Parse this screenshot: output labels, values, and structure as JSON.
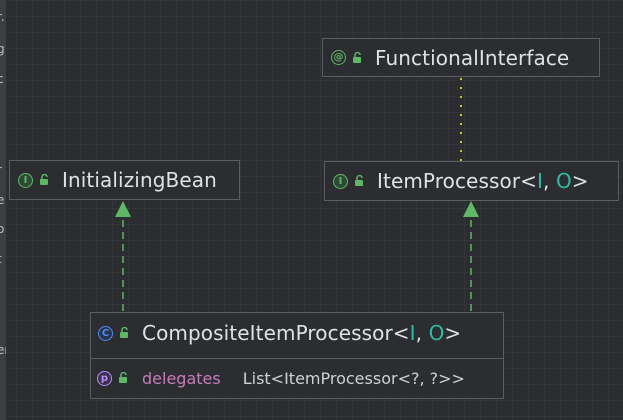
{
  "left_strip_fragments": [
    "r.",
    "g",
    "c",
    "r",
    "e",
    "o",
    "t",
    "er"
  ],
  "nodes": {
    "functional_interface": {
      "kind": "annotation",
      "badge": "@",
      "name": "FunctionalInterface"
    },
    "initializing_bean": {
      "kind": "interface",
      "badge": "I",
      "name": "InitializingBean"
    },
    "item_processor": {
      "kind": "interface",
      "badge": "I",
      "name": "ItemProcessor",
      "type_open": "<",
      "type_param_1": "I",
      "type_sep": ", ",
      "type_param_2": "O",
      "type_close": ">"
    },
    "composite_item_processor": {
      "kind": "class",
      "badge": "C",
      "name": "CompositeItemProcessor",
      "type_open": "<",
      "type_param_1": "I",
      "type_sep": ", ",
      "type_param_2": "O",
      "type_close": ">",
      "members": [
        {
          "badge": "p",
          "name": "delegates",
          "type": "List<ItemProcessor<?, ?>>"
        }
      ]
    }
  },
  "colors": {
    "background": "#2b2d30",
    "node_border": "#5a5d63",
    "implements_arrow": "#5fb865",
    "annotation_link": "#c4c433",
    "type_parameter": "#2fbaa3",
    "member_name": "#c77dbb"
  },
  "edges": [
    {
      "from": "composite_item_processor",
      "to": "initializing_bean",
      "style": "dashed-implements"
    },
    {
      "from": "composite_item_processor",
      "to": "item_processor",
      "style": "dashed-implements"
    },
    {
      "from": "item_processor",
      "to": "functional_interface",
      "style": "dotted-annotation"
    }
  ]
}
